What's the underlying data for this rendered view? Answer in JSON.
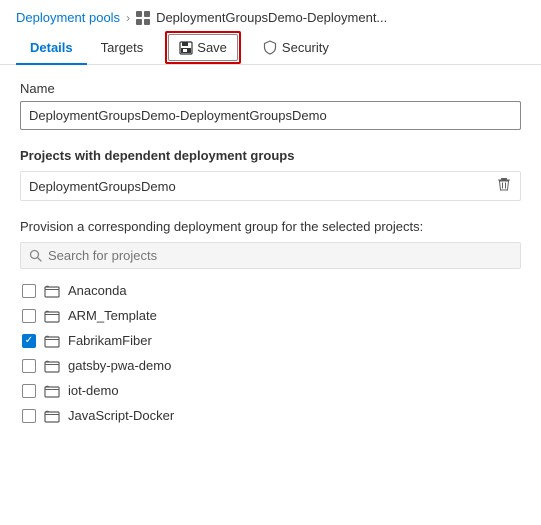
{
  "breadcrumb": {
    "link_label": "Deployment pools",
    "separator": "›",
    "current_icon": "deployment-group-icon",
    "current_label": "DeploymentGroupsDemo-Deployment..."
  },
  "tabs": [
    {
      "id": "details",
      "label": "Details",
      "active": true
    },
    {
      "id": "targets",
      "label": "Targets",
      "active": false
    }
  ],
  "save_button": {
    "label": "Save",
    "icon": "save-icon"
  },
  "security_tab": {
    "label": "Security",
    "icon": "shield-icon"
  },
  "form": {
    "name_label": "Name",
    "name_value": "DeploymentGroupsDemo-DeploymentGroupsDemo",
    "dependent_groups_label": "Projects with dependent deployment groups",
    "dependent_project": "DeploymentGroupsDemo",
    "provision_label": "Provision a corresponding deployment group for the selected projects:",
    "search_placeholder": "Search for projects",
    "projects": [
      {
        "id": "anaconda",
        "name": "Anaconda",
        "checked": false
      },
      {
        "id": "arm-template",
        "name": "ARM_Template",
        "checked": false
      },
      {
        "id": "fabrikamfiber",
        "name": "FabrikamFiber",
        "checked": true
      },
      {
        "id": "gatsby-pwa-demo",
        "name": "gatsby-pwa-demo",
        "checked": false
      },
      {
        "id": "iot-demo",
        "name": "iot-demo",
        "checked": false
      },
      {
        "id": "javascript-docker",
        "name": "JavaScript-Docker",
        "checked": false
      }
    ]
  },
  "icons": {
    "save": "💾",
    "shield": "🛡",
    "grid": "⊞",
    "trash": "🗑",
    "search": "🔍",
    "project": "📁"
  }
}
